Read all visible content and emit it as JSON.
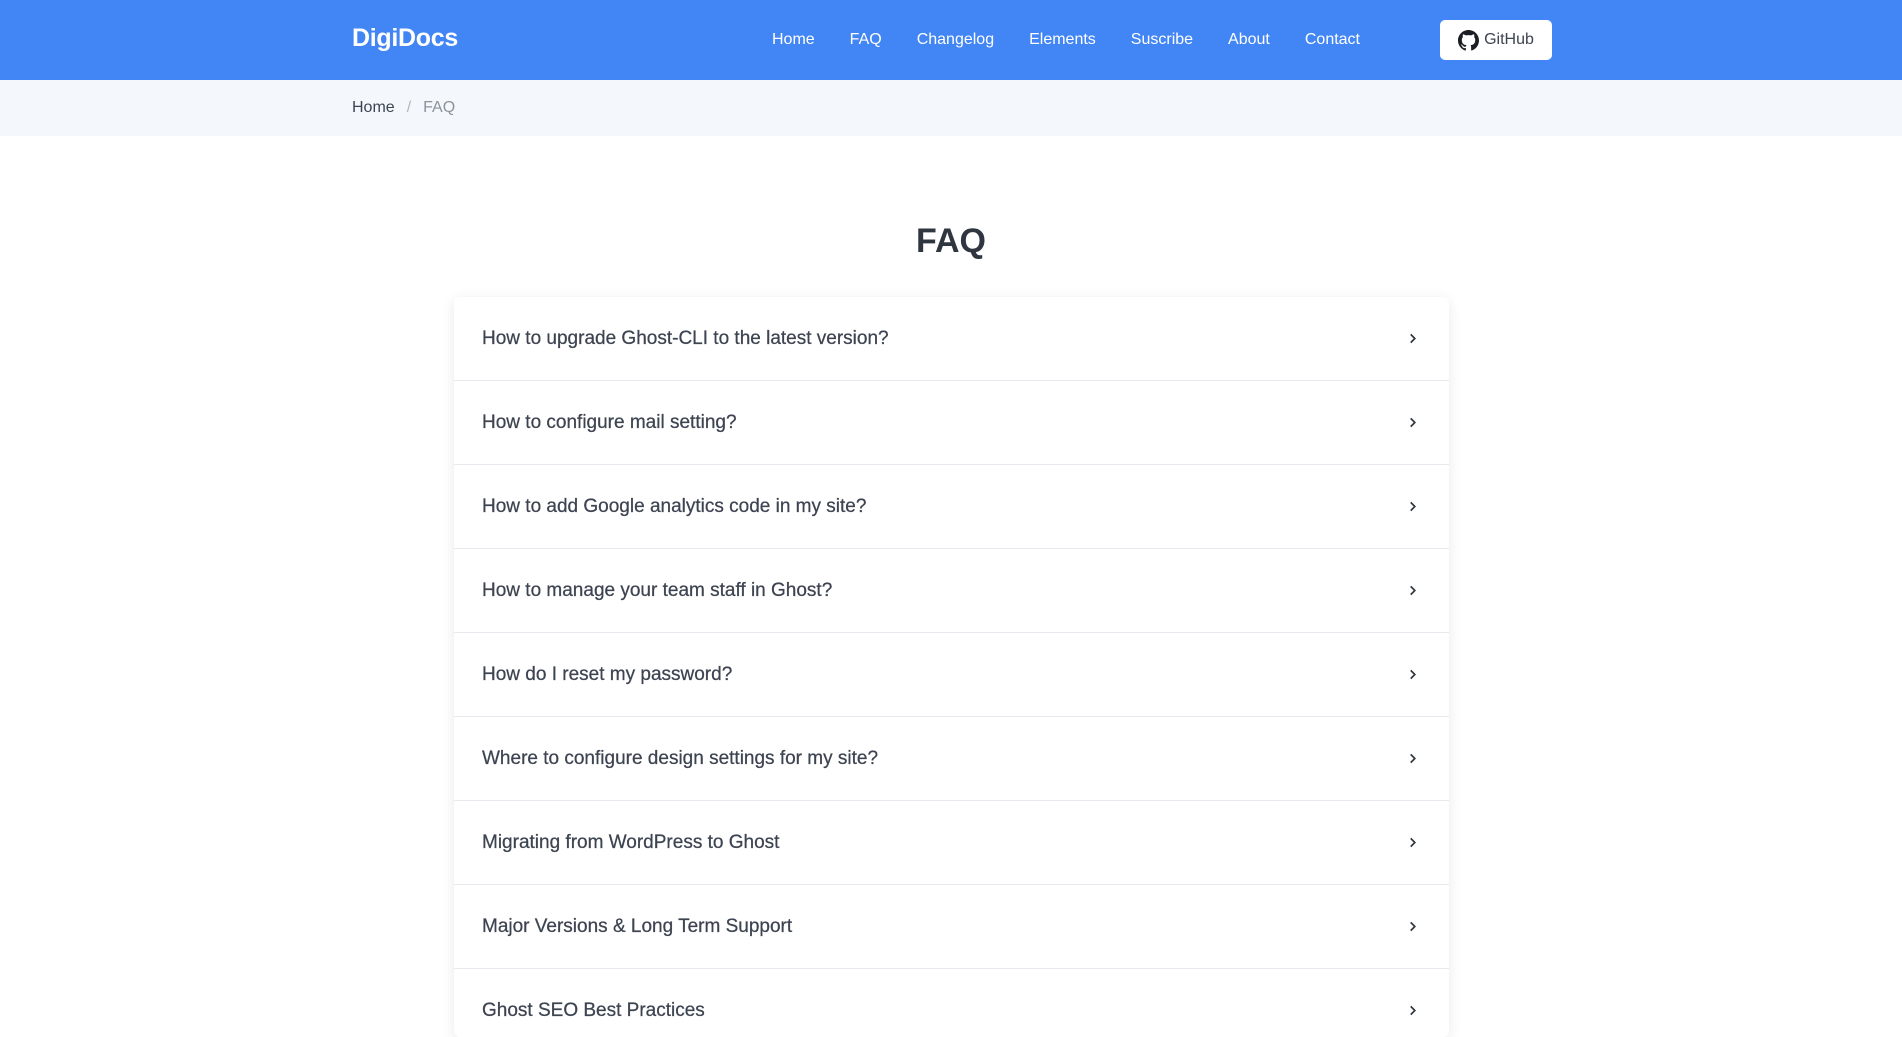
{
  "navbar": {
    "brand": "DigiDocs",
    "links": [
      "Home",
      "FAQ",
      "Changelog",
      "Elements",
      "Suscribe",
      "About",
      "Contact"
    ],
    "github_label": "GitHub"
  },
  "breadcrumb": {
    "home": "Home",
    "separator": "/",
    "current": "FAQ"
  },
  "page": {
    "title": "FAQ"
  },
  "faq": {
    "items": [
      "How to upgrade Ghost-CLI to the latest version?",
      "How to configure mail setting?",
      "How to add Google analytics code in my site?",
      "How to manage your team staff in Ghost?",
      "How do I reset my password?",
      "Where to configure design settings for my site?",
      "Migrating from WordPress to Ghost",
      "Major Versions & Long Term Support",
      "Ghost SEO Best Practices"
    ]
  },
  "colors": {
    "navbar_bg": "#4285f4",
    "breadcrumb_bg": "#f4f8fc",
    "text_dark": "#2f3640"
  }
}
